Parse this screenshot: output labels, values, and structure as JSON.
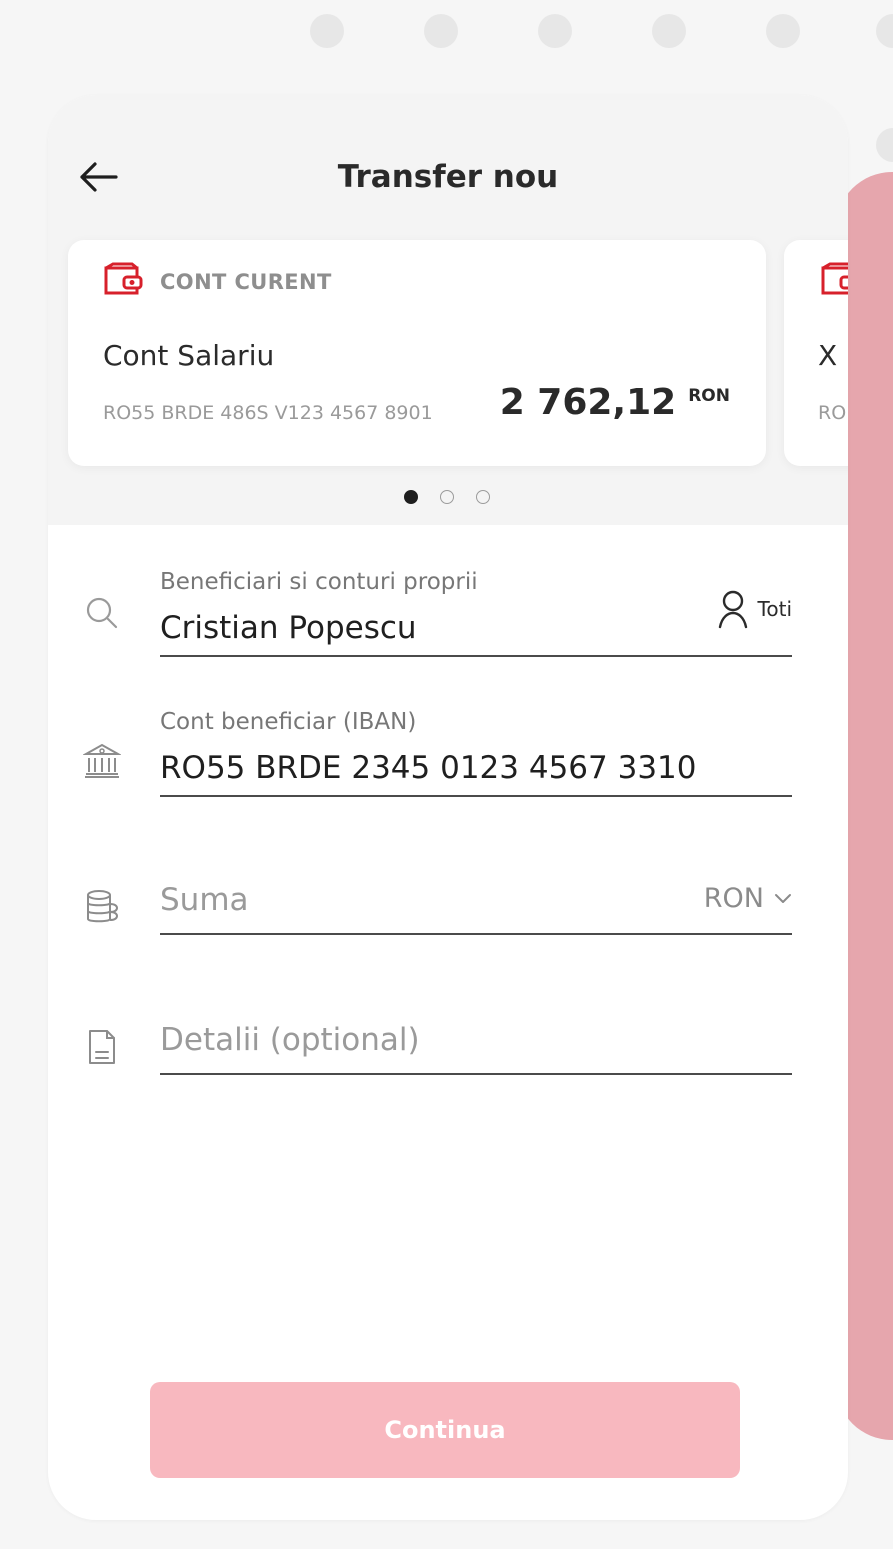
{
  "header": {
    "title": "Transfer nou"
  },
  "accounts": [
    {
      "type": "CONT CURENT",
      "name": "Cont Salariu",
      "iban": "RO55 BRDE 486S V123 4567 8901",
      "balance": "2 762,12",
      "currency": "RON"
    },
    {
      "name": "X",
      "iban": "RO"
    }
  ],
  "pager": {
    "total_pages": 3,
    "active_page": 1
  },
  "form": {
    "beneficiary": {
      "label": "Beneficiari si conturi proprii",
      "value": "Cristian Popescu",
      "all_label": "Toti"
    },
    "iban": {
      "label": "Cont beneficiar (IBAN)",
      "value": "RO55 BRDE 2345 0123 4567 3310"
    },
    "amount": {
      "placeholder": "Suma",
      "currency": "RON"
    },
    "details": {
      "placeholder": "Detalii (optional)"
    }
  },
  "actions": {
    "continue_label": "Continua"
  },
  "colors": {
    "brand_red": "#d7202b",
    "side_panel": "#e6a6ad",
    "continue_button": "#f8b8bf",
    "text_primary": "#2a2a2a",
    "text_muted": "#9a9a9a"
  },
  "icons": {
    "back": "arrow-left-icon",
    "wallet": "wallet-icon",
    "search": "search-icon",
    "contact": "person-icon",
    "bank": "bank-icon",
    "amount": "coins-icon",
    "details": "document-icon",
    "dropdown": "chevron-down-icon"
  }
}
